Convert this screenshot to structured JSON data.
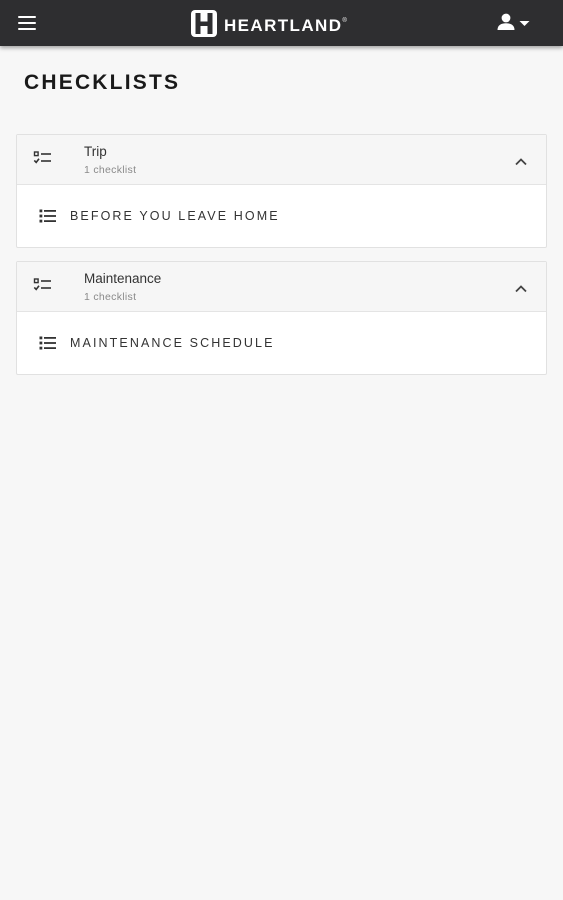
{
  "header": {
    "brand": "HEARTLAND",
    "trademark": "®",
    "menu_icon": "hamburger-menu-icon",
    "account_icon": "person-icon",
    "account_dropdown_icon": "caret-down-icon",
    "background_color": "#2e2e30"
  },
  "page": {
    "title": "CHECKLISTS"
  },
  "groups": [
    {
      "name": "Trip",
      "count_label": "1 checklist",
      "icon": "checklist-icon",
      "expanded": true,
      "items": [
        {
          "label": "BEFORE YOU LEAVE HOME",
          "icon": "list-icon"
        }
      ]
    },
    {
      "name": "Maintenance",
      "count_label": "1 checklist",
      "icon": "checklist-icon",
      "expanded": true,
      "items": [
        {
          "label": "MAINTENANCE SCHEDULE",
          "icon": "list-icon"
        }
      ]
    }
  ]
}
